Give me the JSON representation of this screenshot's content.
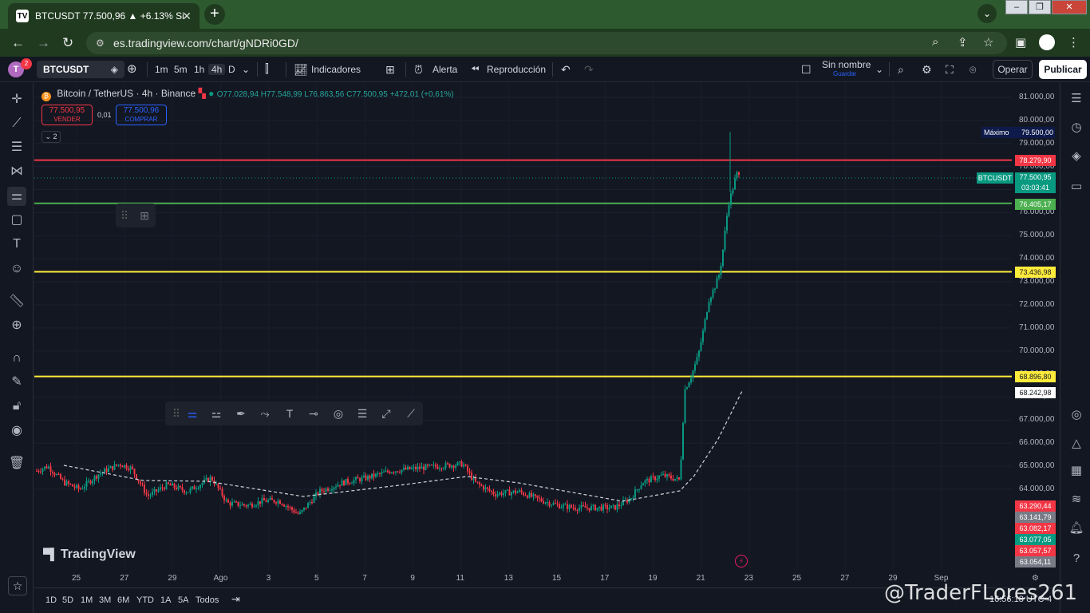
{
  "browser": {
    "tab_title": "BTCUSDT 77.500,96 ▲ +6.13% Si",
    "url": "es.tradingview.com/chart/gNDRi0GD/"
  },
  "toolbar": {
    "avatar_letter": "T",
    "notification_count": "2",
    "symbol": "BTCUSDT",
    "timeframes": [
      "1m",
      "5m",
      "1h",
      "4h",
      "D"
    ],
    "indicators_label": "Indicadores",
    "alert_label": "Alerta",
    "replay_label": "Reproducción",
    "layout_name": "Sin nombre",
    "layout_sub": "Guardar",
    "trade_label": "Operar",
    "publish_label": "Publicar"
  },
  "legend": {
    "pair": "Bitcoin / TetherUS · 4h · Binance",
    "ohlc": "O77.028,94 H77.548,99 L76.863,56 C77.500,95 +472,01 (+0,61%)",
    "sell_price": "77.500,95",
    "sell_label": "VENDER",
    "spread": "0,01",
    "buy_price": "77.500,96",
    "buy_label": "COMPRAR",
    "collapse_count": "2"
  },
  "chart_data": {
    "type": "candlestick",
    "symbol": "BTCUSDT",
    "price_ticks": [
      "81.000,00",
      "80.000,00",
      "79.000,00",
      "78.000,00",
      "77.000,00",
      "76.000,00",
      "75.000,00",
      "74.000,00",
      "73.000,00",
      "72.000,00",
      "71.000,00",
      "70.000,00",
      "69.000,00",
      "68.000,00",
      "67.000,00",
      "66.000,00",
      "65.000,00",
      "64.000,00"
    ],
    "date_ticks": [
      "25",
      "27",
      "29",
      "Ago",
      "3",
      "5",
      "7",
      "9",
      "11",
      "13",
      "15",
      "17",
      "19",
      "21",
      "23",
      "25",
      "27",
      "29",
      "Sep"
    ],
    "horizontal_lines": [
      {
        "price": 78279.9,
        "label": "78.279,90",
        "color": "#f23645"
      },
      {
        "price": 76405.17,
        "label": "76.405,17",
        "color": "#4caf50"
      },
      {
        "price": 73436.98,
        "label": "73.436,98",
        "color": "#ffeb3b"
      },
      {
        "price": 68896.8,
        "label": "68.896,80",
        "color": "#ffeb3b"
      }
    ],
    "max_label": "Máximo",
    "max_value": "79.500,00",
    "current_tag": "BTCUSDT",
    "current_price": "77.500,95",
    "countdown": "03:03:41",
    "extra_label": "68.242,98",
    "bottom_labels": [
      {
        "value": "63.290,44",
        "color": "#f23645"
      },
      {
        "value": "63.141,79",
        "color": "#787b86"
      },
      {
        "value": "63.082,17",
        "color": "#f23645"
      },
      {
        "value": "63.077,05",
        "color": "#089981"
      },
      {
        "value": "63.057,57",
        "color": "#f23645"
      },
      {
        "value": "63.054,11",
        "color": "#787b86"
      }
    ]
  },
  "ranges": [
    "1D",
    "5D",
    "1M",
    "3M",
    "6M",
    "YTD",
    "1A",
    "5A",
    "Todos"
  ],
  "clock": "16:56:18 UTC-4",
  "watermark": "@TraderFLores261",
  "logo": "TradingView"
}
